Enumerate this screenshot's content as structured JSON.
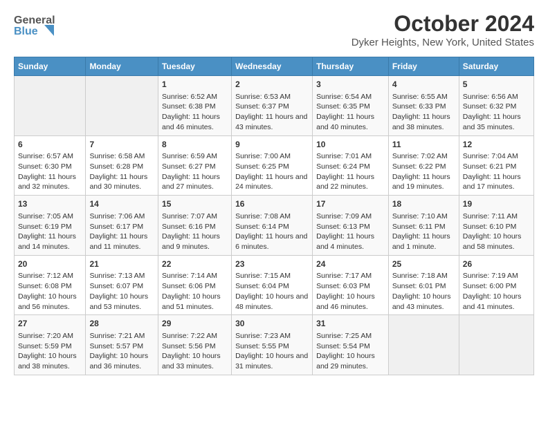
{
  "header": {
    "logo_line1": "General",
    "logo_line2": "Blue",
    "month": "October 2024",
    "location": "Dyker Heights, New York, United States"
  },
  "days_of_week": [
    "Sunday",
    "Monday",
    "Tuesday",
    "Wednesday",
    "Thursday",
    "Friday",
    "Saturday"
  ],
  "weeks": [
    [
      {
        "day": "",
        "content": ""
      },
      {
        "day": "",
        "content": ""
      },
      {
        "day": "1",
        "content": "Sunrise: 6:52 AM\nSunset: 6:38 PM\nDaylight: 11 hours and 46 minutes."
      },
      {
        "day": "2",
        "content": "Sunrise: 6:53 AM\nSunset: 6:37 PM\nDaylight: 11 hours and 43 minutes."
      },
      {
        "day": "3",
        "content": "Sunrise: 6:54 AM\nSunset: 6:35 PM\nDaylight: 11 hours and 40 minutes."
      },
      {
        "day": "4",
        "content": "Sunrise: 6:55 AM\nSunset: 6:33 PM\nDaylight: 11 hours and 38 minutes."
      },
      {
        "day": "5",
        "content": "Sunrise: 6:56 AM\nSunset: 6:32 PM\nDaylight: 11 hours and 35 minutes."
      }
    ],
    [
      {
        "day": "6",
        "content": "Sunrise: 6:57 AM\nSunset: 6:30 PM\nDaylight: 11 hours and 32 minutes."
      },
      {
        "day": "7",
        "content": "Sunrise: 6:58 AM\nSunset: 6:28 PM\nDaylight: 11 hours and 30 minutes."
      },
      {
        "day": "8",
        "content": "Sunrise: 6:59 AM\nSunset: 6:27 PM\nDaylight: 11 hours and 27 minutes."
      },
      {
        "day": "9",
        "content": "Sunrise: 7:00 AM\nSunset: 6:25 PM\nDaylight: 11 hours and 24 minutes."
      },
      {
        "day": "10",
        "content": "Sunrise: 7:01 AM\nSunset: 6:24 PM\nDaylight: 11 hours and 22 minutes."
      },
      {
        "day": "11",
        "content": "Sunrise: 7:02 AM\nSunset: 6:22 PM\nDaylight: 11 hours and 19 minutes."
      },
      {
        "day": "12",
        "content": "Sunrise: 7:04 AM\nSunset: 6:21 PM\nDaylight: 11 hours and 17 minutes."
      }
    ],
    [
      {
        "day": "13",
        "content": "Sunrise: 7:05 AM\nSunset: 6:19 PM\nDaylight: 11 hours and 14 minutes."
      },
      {
        "day": "14",
        "content": "Sunrise: 7:06 AM\nSunset: 6:17 PM\nDaylight: 11 hours and 11 minutes."
      },
      {
        "day": "15",
        "content": "Sunrise: 7:07 AM\nSunset: 6:16 PM\nDaylight: 11 hours and 9 minutes."
      },
      {
        "day": "16",
        "content": "Sunrise: 7:08 AM\nSunset: 6:14 PM\nDaylight: 11 hours and 6 minutes."
      },
      {
        "day": "17",
        "content": "Sunrise: 7:09 AM\nSunset: 6:13 PM\nDaylight: 11 hours and 4 minutes."
      },
      {
        "day": "18",
        "content": "Sunrise: 7:10 AM\nSunset: 6:11 PM\nDaylight: 11 hours and 1 minute."
      },
      {
        "day": "19",
        "content": "Sunrise: 7:11 AM\nSunset: 6:10 PM\nDaylight: 10 hours and 58 minutes."
      }
    ],
    [
      {
        "day": "20",
        "content": "Sunrise: 7:12 AM\nSunset: 6:08 PM\nDaylight: 10 hours and 56 minutes."
      },
      {
        "day": "21",
        "content": "Sunrise: 7:13 AM\nSunset: 6:07 PM\nDaylight: 10 hours and 53 minutes."
      },
      {
        "day": "22",
        "content": "Sunrise: 7:14 AM\nSunset: 6:06 PM\nDaylight: 10 hours and 51 minutes."
      },
      {
        "day": "23",
        "content": "Sunrise: 7:15 AM\nSunset: 6:04 PM\nDaylight: 10 hours and 48 minutes."
      },
      {
        "day": "24",
        "content": "Sunrise: 7:17 AM\nSunset: 6:03 PM\nDaylight: 10 hours and 46 minutes."
      },
      {
        "day": "25",
        "content": "Sunrise: 7:18 AM\nSunset: 6:01 PM\nDaylight: 10 hours and 43 minutes."
      },
      {
        "day": "26",
        "content": "Sunrise: 7:19 AM\nSunset: 6:00 PM\nDaylight: 10 hours and 41 minutes."
      }
    ],
    [
      {
        "day": "27",
        "content": "Sunrise: 7:20 AM\nSunset: 5:59 PM\nDaylight: 10 hours and 38 minutes."
      },
      {
        "day": "28",
        "content": "Sunrise: 7:21 AM\nSunset: 5:57 PM\nDaylight: 10 hours and 36 minutes."
      },
      {
        "day": "29",
        "content": "Sunrise: 7:22 AM\nSunset: 5:56 PM\nDaylight: 10 hours and 33 minutes."
      },
      {
        "day": "30",
        "content": "Sunrise: 7:23 AM\nSunset: 5:55 PM\nDaylight: 10 hours and 31 minutes."
      },
      {
        "day": "31",
        "content": "Sunrise: 7:25 AM\nSunset: 5:54 PM\nDaylight: 10 hours and 29 minutes."
      },
      {
        "day": "",
        "content": ""
      },
      {
        "day": "",
        "content": ""
      }
    ]
  ]
}
